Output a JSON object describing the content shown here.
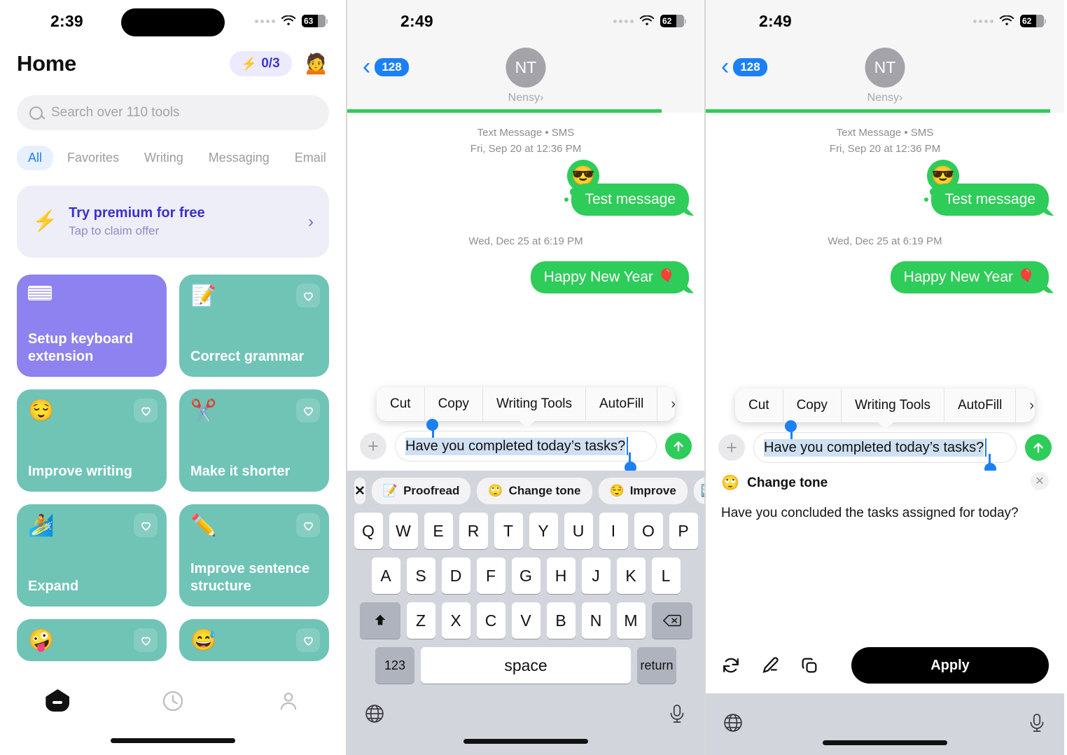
{
  "panel1": {
    "status": {
      "time": "2:39",
      "battery": "63",
      "wifi_icon": "wifi-icon",
      "signal_icon": "cellular-dots-icon"
    },
    "header": {
      "title": "Home",
      "credits": "0/3",
      "bolt_icon": "lightning-bolt-icon",
      "avatar_emoji": "🙍"
    },
    "search": {
      "placeholder": "Search over 110 tools",
      "icon": "search-icon"
    },
    "chips": [
      {
        "label": "All",
        "active": true
      },
      {
        "label": "Favorites",
        "active": false
      },
      {
        "label": "Writing",
        "active": false
      },
      {
        "label": "Messaging",
        "active": false
      },
      {
        "label": "Email",
        "active": false
      }
    ],
    "promo": {
      "title": "Try premium for free",
      "subtitle": "Tap to claim offer",
      "icon": "lightning-bolt-icon",
      "chevron": "›"
    },
    "cards": [
      {
        "label": "Setup keyboard extension",
        "emoji": "",
        "icon": "keyboard-icon",
        "color": "#8d82ef",
        "fav": false
      },
      {
        "label": "Correct grammar",
        "emoji": "📝",
        "color": "#6fc4b6",
        "fav": true
      },
      {
        "label": "Improve writing",
        "emoji": "😌",
        "color": "#6fc4b6",
        "fav": true
      },
      {
        "label": "Make it shorter",
        "emoji": "✂️",
        "color": "#6fc4b6",
        "fav": true
      },
      {
        "label": "Expand",
        "emoji": "🏄",
        "color": "#6fc4b6",
        "fav": true
      },
      {
        "label": "Improve sentence structure",
        "emoji": "✏️",
        "color": "#6fc4b6",
        "fav": true
      },
      {
        "label": "",
        "emoji": "🤪",
        "color": "#6fc4b6",
        "fav": true
      },
      {
        "label": "",
        "emoji": "😅",
        "color": "#6fc4b6",
        "fav": true
      }
    ],
    "tabs": [
      {
        "name": "home-tab",
        "icon": "home-icon",
        "active": true
      },
      {
        "name": "history-tab",
        "icon": "clock-icon",
        "active": false
      },
      {
        "name": "profile-tab",
        "icon": "person-icon",
        "active": false
      }
    ]
  },
  "panel2": {
    "status": {
      "time": "2:49",
      "battery": "62"
    },
    "nav": {
      "back_count": "128",
      "back_icon": "chevron-left-icon",
      "avatar_initials": "NT",
      "contact_name": "Nensy",
      "contact_chevron": "›"
    },
    "thread": {
      "meta1_line1": "Text Message • SMS",
      "meta1_line2": "Fri, Sep 20 at 12:36 PM",
      "message1": "Test message",
      "reaction_emoji": "😎",
      "meta2": "Wed, Dec 25 at 6:19 PM",
      "message2": "Happy New Year 🎈"
    },
    "context_menu": [
      {
        "label": "Cut"
      },
      {
        "label": "Copy"
      },
      {
        "label": "Writing Tools"
      },
      {
        "label": "AutoFill"
      },
      {
        "label": "›"
      }
    ],
    "composer": {
      "plus_icon": "plus-icon",
      "text": "Have you completed today’s tasks?",
      "send_icon": "send-arrow-up-icon"
    },
    "suggestions": [
      {
        "label": "",
        "emoji": "✕",
        "name": "close-suggestions-button"
      },
      {
        "label": "Proofread",
        "emoji": "📝",
        "name": "proofread-button"
      },
      {
        "label": "Change tone",
        "emoji": "🙄",
        "name": "change-tone-button"
      },
      {
        "label": "Improve",
        "emoji": "😌",
        "name": "improve-button"
      },
      {
        "label": "",
        "emoji": "🔄",
        "name": "refresh-button"
      }
    ],
    "keyboard": {
      "row1": [
        "Q",
        "W",
        "E",
        "R",
        "T",
        "Y",
        "U",
        "I",
        "O",
        "P"
      ],
      "row2": [
        "A",
        "S",
        "D",
        "F",
        "G",
        "H",
        "J",
        "K",
        "L"
      ],
      "row3": [
        "Z",
        "X",
        "C",
        "V",
        "B",
        "N",
        "M"
      ],
      "shift": "shift-key",
      "backspace": "backspace-key",
      "numbers": "123",
      "space": "space",
      "return": "return",
      "globe_icon": "globe-icon",
      "mic_icon": "microphone-icon"
    }
  },
  "panel3": {
    "status": {
      "time": "2:49",
      "battery": "62"
    },
    "nav": {
      "back_count": "128",
      "avatar_initials": "NT",
      "contact_name": "Nensy",
      "contact_chevron": "›"
    },
    "thread": {
      "meta1_line1": "Text Message • SMS",
      "meta1_line2": "Fri, Sep 20 at 12:36 PM",
      "message1": "Test message",
      "reaction_emoji": "😎",
      "meta2": "Wed, Dec 25 at 6:19 PM",
      "message2": "Happy New Year 🎈"
    },
    "context_menu": [
      {
        "label": "Cut"
      },
      {
        "label": "Copy"
      },
      {
        "label": "Writing Tools"
      },
      {
        "label": "AutoFill"
      },
      {
        "label": "›"
      }
    ],
    "composer": {
      "text": "Have you completed today’s tasks?"
    },
    "tone_result": {
      "emoji": "🙄",
      "title": "Change tone",
      "close_icon": "close-icon",
      "body": "Have you concluded the tasks assigned for today?",
      "actions": [
        {
          "name": "regenerate-icon"
        },
        {
          "name": "edit-pencil-icon"
        },
        {
          "name": "copy-icon"
        }
      ],
      "apply_label": "Apply"
    },
    "keyboard_bottom": {
      "globe_icon": "globe-icon",
      "mic_icon": "microphone-icon"
    }
  },
  "colors": {
    "accent_purple": "#4b43e0",
    "accent_blue": "#1b80f6",
    "bubble_green": "#2ecc58",
    "card_teal": "#6fc4b6",
    "card_purple": "#8d82ef"
  }
}
